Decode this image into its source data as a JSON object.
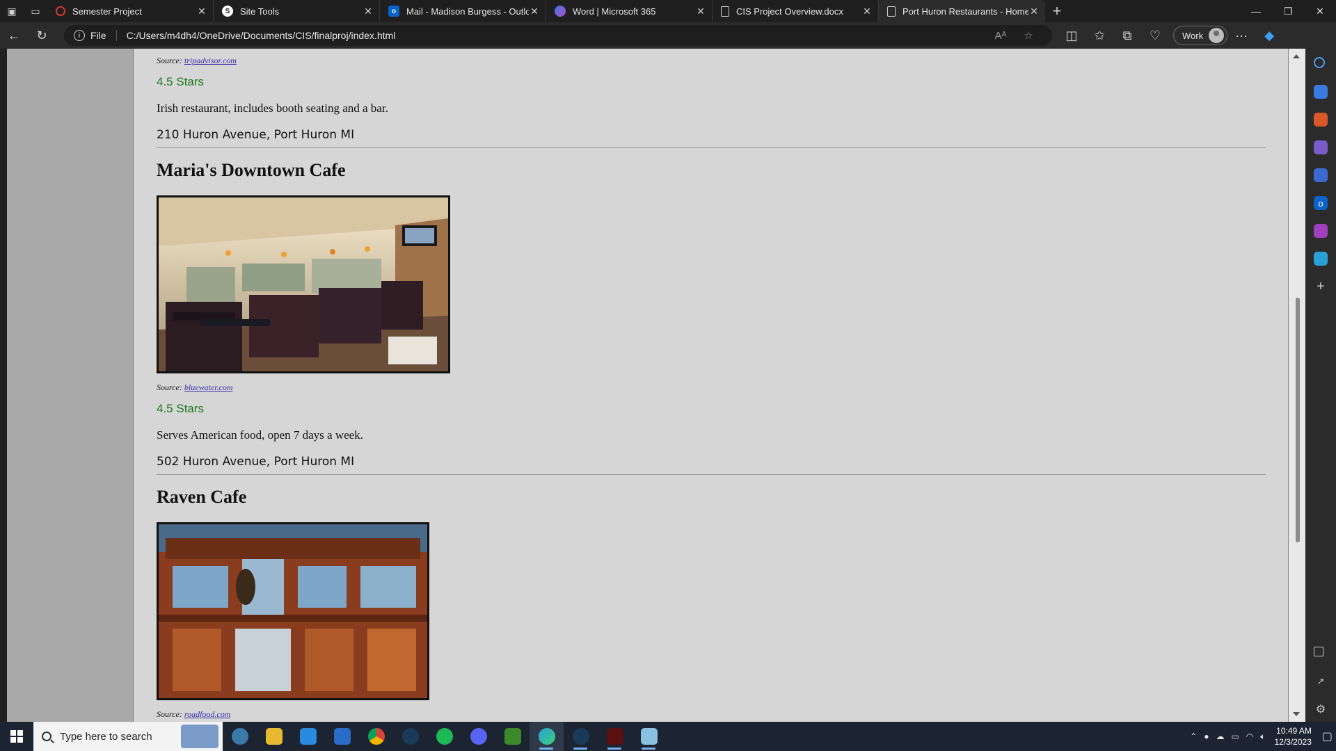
{
  "browser": {
    "tabs": [
      {
        "title": "Semester Project",
        "favicon": "semester-icon",
        "color": "#d43a2f"
      },
      {
        "title": "Site Tools",
        "favicon": "site-tools-icon",
        "color": "#ffffff"
      },
      {
        "title": "Mail - Madison Burgess - Outlook",
        "favicon": "outlook-icon",
        "color": "#0a64c8"
      },
      {
        "title": "Word | Microsoft 365",
        "favicon": "m365-icon",
        "color": "#7a5cc8"
      },
      {
        "title": "CIS Project Overview.docx",
        "favicon": "document-icon",
        "color": "#cfcfcf"
      },
      {
        "title": "Port Huron Restaurants - Home Page",
        "favicon": "document-icon",
        "color": "#cfcfcf"
      }
    ],
    "address": {
      "protocol": "File",
      "url": "C:/Users/m4dh4/OneDrive/Documents/CIS/finalproj/index.html"
    },
    "profile_label": "Work"
  },
  "page": {
    "top_entry": {
      "source_prefix": "Source:",
      "source_link": "tripadvisor.com",
      "stars": "4.5 Stars",
      "description": "Irish restaurant, includes booth seating and a bar.",
      "address": "210 Huron Avenue, Port Huron MI"
    },
    "restaurants": [
      {
        "name": "Maria's Downtown Cafe",
        "source_prefix": "Source:",
        "source_link": "bluewater.com",
        "stars": "4.5 Stars",
        "description": "Serves American food, open 7 days a week.",
        "address": "502 Huron Avenue, Port Huron MI"
      },
      {
        "name": "Raven Cafe",
        "source_prefix": "Source:",
        "source_link": "roadfood.com"
      }
    ]
  },
  "taskbar": {
    "search_placeholder": "Type here to search",
    "time": "10:49 AM",
    "date": "12/3/2023"
  },
  "colors": {
    "stars": "#1a7a1a",
    "link": "#3a2aa8",
    "page_bg": "#d6d6d6",
    "sidebar": "#a9a9a9"
  }
}
